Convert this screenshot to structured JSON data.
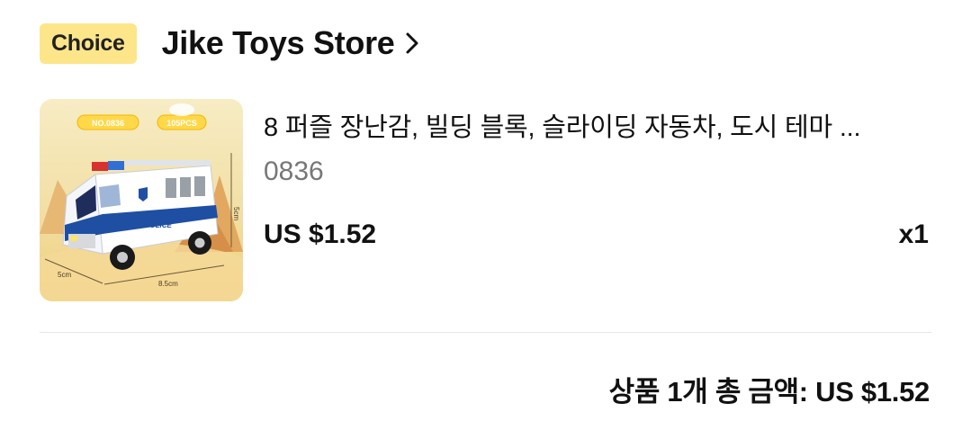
{
  "store": {
    "badge": "Choice",
    "name": "Jike Toys Store",
    "chevron_icon": "chevron-right-icon"
  },
  "product": {
    "title": "8 퍼즐 장난감, 빌딩 블록, 슬라이딩 자동차, 도시 테마 ...",
    "sku": "0836",
    "price": "US $1.52",
    "quantity": "x1",
    "image": {
      "model_tag": "NO.0836",
      "pieces_tag": "105PCS",
      "vehicle_label": "POLICE",
      "dim_height": "5cm",
      "dim_width": "5cm",
      "dim_length": "8.5cm"
    }
  },
  "summary": {
    "total": "상품 1개 총 금액: US $1.52"
  },
  "colors": {
    "badge_bg": "#fde58a",
    "text_primary": "#111111",
    "text_secondary": "#777777",
    "divider": "#e6e6e6"
  }
}
